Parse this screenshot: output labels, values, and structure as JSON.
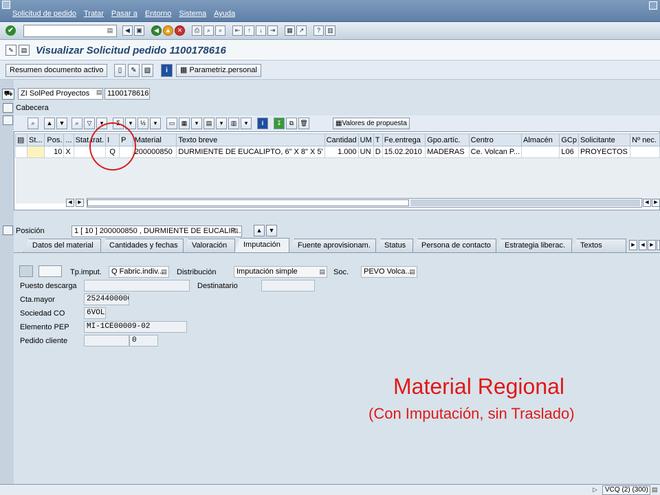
{
  "menu": {
    "items": [
      "Solicitud de pedido",
      "Tratar",
      "Pasar a",
      "Entorno",
      "Sistema",
      "Ayuda"
    ]
  },
  "command_field": {
    "value": ""
  },
  "title": "Visualizar Solicitud pedido 1100178616",
  "app_toolbar": {
    "summary_button": "Resumen documento activo",
    "personal_settings_button": "Parametriz.personal"
  },
  "header": {
    "doc_type": "ZI SolPed Proyectos",
    "doc_number": "1100178616",
    "cabecera_label": "Cabecera"
  },
  "grid": {
    "proposal_button": "Valores de propuesta",
    "columns": [
      "St...",
      "Pos.",
      "...",
      "Stat.trat.",
      "I",
      "P",
      "Material",
      "Texto breve",
      "Cantidad",
      "UM",
      "T",
      "Fe.entrega",
      "Gpo.artíc.",
      "Centro",
      "Almacén",
      "GCp",
      "Solicitante",
      "Nº nec."
    ],
    "rows": [
      {
        "st": "",
        "pos": "10",
        "flag": "X",
        "stat": "",
        "i": "Q",
        "p": "",
        "material": "200000850",
        "texto": "DURMIENTE DE EUCALIPTO, 6\" X 8\" X 5'",
        "cantidad": "1.000",
        "um": "UN",
        "t": "D",
        "fecha": "15.02.2010",
        "gpo": "MADERAS",
        "centro": "Ce. Volcan P...",
        "almacen": "",
        "gcp": "L06",
        "solicitante": "PROYECTOS",
        "nec": ""
      }
    ]
  },
  "item_selector": {
    "label": "Posición",
    "value": "1 [ 10 ] 200000850 , DURMIENTE DE EUCALIP..."
  },
  "tabs": [
    "Datos del material",
    "Cantidades y fechas",
    "Valoración",
    "Imputación",
    "Fuente aprovisionam.",
    "Status",
    "Persona de contacto",
    "Estrategia liberac.",
    "Textos"
  ],
  "active_tab": "Imputación",
  "imputacion": {
    "tp_imput_label": "Tp.imput.",
    "tp_imput_value": "Q Fabric.indiv...",
    "distribucion_label": "Distribución",
    "distribucion_value": "Imputación simple",
    "soc_label": "Soc.",
    "soc_value": "PEVO Volca...",
    "puesto_label": "Puesto descarga",
    "puesto_value": "",
    "destinatario_label": "Destinatario",
    "destinatario_value": "",
    "cta_label": "Cta.mayor",
    "cta_value": "2524400000",
    "sociedad_label": "Sociedad CO",
    "sociedad_value": "6VOL",
    "pep_label": "Elemento PEP",
    "pep_value": "MI-1CE00009-02",
    "pedido_label": "Pedido cliente",
    "pedido_value": "",
    "pedido_pos_value": "0"
  },
  "annotation": {
    "title": "Material Regional",
    "subtitle": "(Con Imputación, sin Traslado)"
  },
  "status": {
    "system": "VCQ (2) (300)"
  },
  "colors": {
    "annotation": "#e01818",
    "title": "#21466f",
    "menubar": "#6b8bb2",
    "selected_cell": "#fdf3c0"
  }
}
